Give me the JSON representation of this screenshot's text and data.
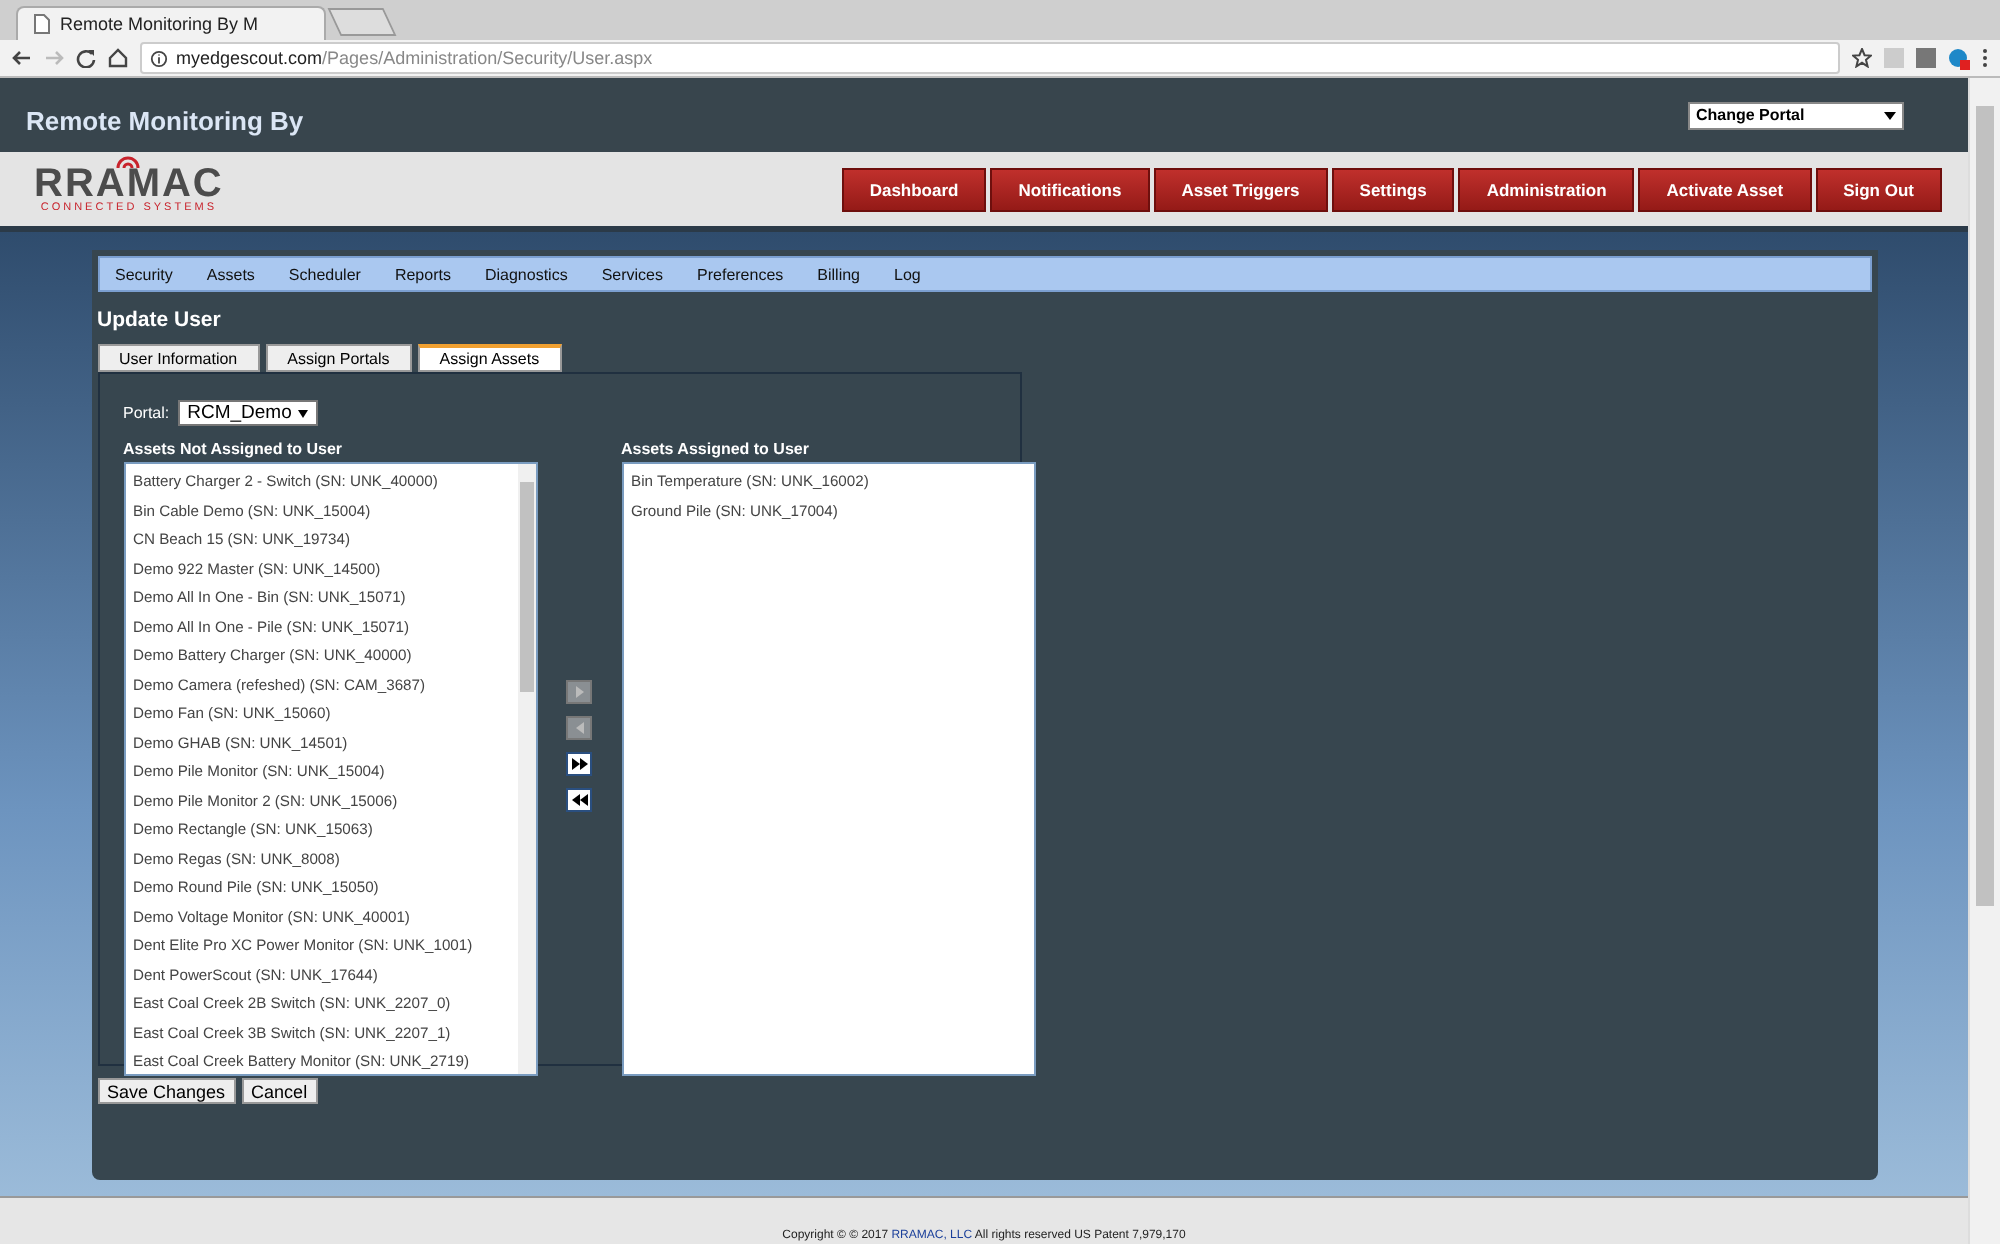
{
  "browser": {
    "tab_title": "Remote Monitoring By M",
    "url_host": "myedgescout.com",
    "url_path": "/Pages/Administration/Security/User.aspx"
  },
  "header": {
    "title": "Remote Monitoring By",
    "portal_select": "Change Portal"
  },
  "logo": {
    "name": "RRAMAC",
    "tagline": "CONNECTED SYSTEMS"
  },
  "main_nav": [
    "Dashboard",
    "Notifications",
    "Asset Triggers",
    "Settings",
    "Administration",
    "Activate Asset",
    "Sign Out"
  ],
  "sub_nav": [
    "Security",
    "Assets",
    "Scheduler",
    "Reports",
    "Diagnostics",
    "Services",
    "Preferences",
    "Billing",
    "Log"
  ],
  "page_title": "Update User",
  "tabs": [
    {
      "label": "User Information",
      "selected": false
    },
    {
      "label": "Assign Portals",
      "selected": false
    },
    {
      "label": "Assign Assets",
      "selected": true
    }
  ],
  "portal": {
    "label": "Portal:",
    "value": "RCM_Demo"
  },
  "not_assigned": {
    "heading": "Assets Not Assigned to User",
    "items": [
      "Battery Charger 2 - Switch (SN: UNK_40000)",
      "Bin Cable Demo (SN: UNK_15004)",
      "CN Beach 15 (SN: UNK_19734)",
      "Demo 922 Master (SN: UNK_14500)",
      "Demo All In One - Bin (SN: UNK_15071)",
      "Demo All In One - Pile (SN: UNK_15071)",
      "Demo Battery Charger (SN: UNK_40000)",
      "Demo Camera (refeshed) (SN: CAM_3687)",
      "Demo Fan (SN: UNK_15060)",
      "Demo GHAB (SN: UNK_14501)",
      "Demo Pile Monitor (SN: UNK_15004)",
      "Demo Pile Monitor 2 (SN: UNK_15006)",
      "Demo Rectangle (SN: UNK_15063)",
      "Demo Regas (SN: UNK_8008)",
      "Demo Round Pile (SN: UNK_15050)",
      "Demo Voltage Monitor (SN: UNK_40001)",
      "Dent Elite Pro XC Power Monitor (SN: UNK_1001)",
      "Dent PowerScout (SN: UNK_17644)",
      "East Coal Creek 2B Switch (SN: UNK_2207_0)",
      "East Coal Creek 3B Switch (SN: UNK_2207_1)",
      "East Coal Creek Battery Monitor (SN: UNK_2719)"
    ]
  },
  "move_buttons": [
    {
      "kind": "add",
      "disabled": true
    },
    {
      "kind": "remove",
      "disabled": true
    },
    {
      "kind": "add_all",
      "disabled": false
    },
    {
      "kind": "remove_all",
      "disabled": false
    }
  ],
  "assigned": {
    "heading": "Assets Assigned to User",
    "items": [
      "Bin Temperature (SN: UNK_16002)",
      "Ground Pile (SN: UNK_17004)"
    ]
  },
  "actions": [
    "Save Changes",
    "Cancel"
  ],
  "footer": {
    "text_before": "Copyright © © 2017",
    "link": "RRAMAC, LLC",
    "text_after": "All rights reserved US Patent 7,979,170"
  }
}
